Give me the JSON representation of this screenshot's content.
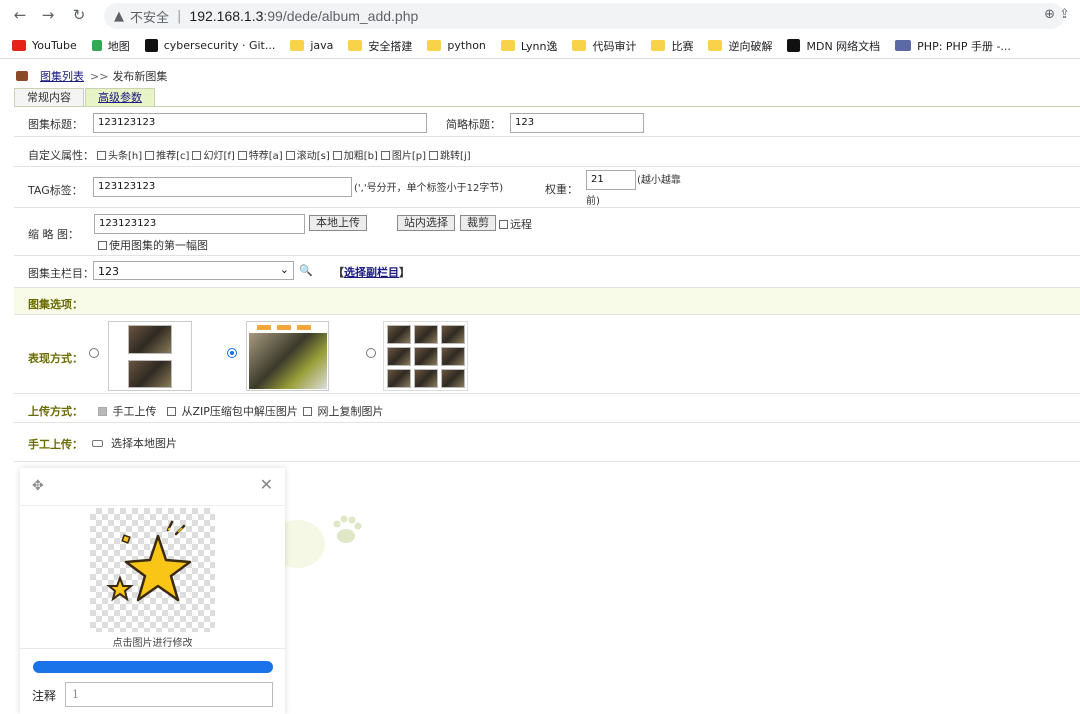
{
  "browser": {
    "back": "←",
    "forward": "→",
    "reload": "↻",
    "security_icon": "▲",
    "not_secure": "不安全",
    "separator": "|",
    "host": "192.168.1.3",
    "path": ":99/dede/album_add.php",
    "bookmarks": [
      {
        "label": "YouTube",
        "icon": "youtube-icon"
      },
      {
        "label": "地图",
        "icon": "maps-icon"
      },
      {
        "label": "cybersecurity · Git...",
        "icon": "github-icon"
      },
      {
        "label": "java",
        "icon": "folder-icon"
      },
      {
        "label": "安全搭建",
        "icon": "folder-icon"
      },
      {
        "label": "python",
        "icon": "folder-icon"
      },
      {
        "label": "Lynn逸",
        "icon": "folder-icon"
      },
      {
        "label": "代码审计",
        "icon": "folder-icon"
      },
      {
        "label": "比赛",
        "icon": "folder-icon"
      },
      {
        "label": "逆向破解",
        "icon": "folder-icon"
      },
      {
        "label": "MDN 网络文档",
        "icon": "mdn-icon"
      },
      {
        "label": "PHP: PHP 手册 -...",
        "icon": "php-icon"
      }
    ]
  },
  "breadcrumb": {
    "link": "图集列表",
    "sep": ">>",
    "current": "发布新图集"
  },
  "tabs": [
    {
      "label": "常规内容"
    },
    {
      "label": "高级参数"
    }
  ],
  "form": {
    "title_label": "图集标题：",
    "title_value": "123123123",
    "short_title_label": "简略标题：",
    "short_title_value": "123",
    "custom_attr_label": "自定义属性：",
    "custom_attrs": [
      "头条[h]",
      "推荐[c]",
      "幻灯[f]",
      "特荐[a]",
      "滚动[s]",
      "加粗[b]",
      "图片[p]",
      "跳转[j]"
    ],
    "tag_label": "TAG标签：",
    "tag_value": "123123123",
    "tag_hint": "(','号分开，单个标签小于12字节)",
    "weight_label": "权重：",
    "weight_value": "21",
    "weight_hint_1": "(越小越靠",
    "weight_hint_2": "前)",
    "thumb_label": "缩 略 图：",
    "thumb_value": "123123123",
    "upload_local": "本地上传",
    "site_select": "站内选择",
    "crop": "裁剪",
    "remote": "远程",
    "use_first": "使用图集的第一幅图",
    "category_label": "图集主栏目：",
    "category_value": "123",
    "select_sub": "选择副栏目",
    "select_sub_left": "【",
    "select_sub_right": "】",
    "options_header": "图集选项：",
    "display_label": "表现方式：",
    "upload_mode_label": "上传方式：",
    "upload_modes": [
      "手工上传",
      "从ZIP压缩包中解压图片",
      "网上复制图片"
    ],
    "manual_label": "手工上传：",
    "choose_local": "选择本地图片"
  },
  "popup": {
    "caption": "点击图片进行修改",
    "note_label": "注释",
    "note_value": "1",
    "progress": 1.0
  },
  "colors": {
    "accent": "#1a73e8",
    "tab_active": "#e8f3c8",
    "options_bg": "#f8fbe8",
    "olive": "#6b6b00"
  }
}
